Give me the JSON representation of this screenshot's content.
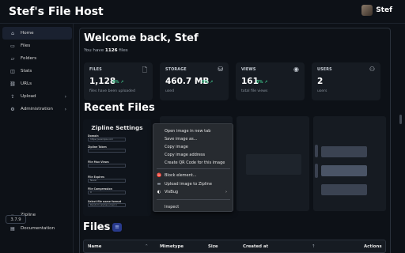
{
  "app": {
    "title": "Stef's File Host",
    "user_name": "Stef"
  },
  "sidebar": {
    "items": [
      {
        "label": "Home",
        "icon": "⌂"
      },
      {
        "label": "Files",
        "icon": "▭"
      },
      {
        "label": "Folders",
        "icon": "▱"
      },
      {
        "label": "Stats",
        "icon": "◫"
      },
      {
        "label": "URLs",
        "icon": "⛓"
      },
      {
        "label": "Upload",
        "icon": "⇪",
        "chevron": "›"
      },
      {
        "label": "Administration",
        "icon": "⚙",
        "chevron": "›"
      }
    ],
    "bottom_items": [
      {
        "label": "Zipline",
        "icon": "⌁"
      },
      {
        "label": "Documentation",
        "icon": "▤"
      }
    ],
    "version": "3.7.9"
  },
  "main": {
    "welcome": "Welcome back, Stef",
    "subtext_prefix": "You have ",
    "file_count": "1126",
    "subtext_suffix": " files",
    "stats": [
      {
        "label": "FILES",
        "icon": "🗋",
        "value": "1,128",
        "change": "0% ↗",
        "sub": "files have been uploaded"
      },
      {
        "label": "STORAGE",
        "icon": "⛁",
        "value": "460.7 MB",
        "change": "0% ↗",
        "sub": "used"
      },
      {
        "label": "VIEWS",
        "icon": "◉",
        "value": "161",
        "change": "0% ↗",
        "sub": "total file views"
      },
      {
        "label": "USERS",
        "icon": "⚇",
        "value": "2",
        "change": "",
        "sub": "users"
      }
    ],
    "recent_title": "Recent Files",
    "files_title": "Files",
    "files_button_icon": "≡"
  },
  "thumbnail": {
    "title": "Zipline Settings",
    "fields": [
      {
        "label": "Domain",
        "value": "https://example.com"
      },
      {
        "label": "Zipline Token",
        "value": ""
      },
      {
        "label": "File Max Views",
        "value": ""
      },
      {
        "label": "File Expires",
        "value": "Never"
      },
      {
        "label": "File Compression",
        "value": "0"
      },
      {
        "label": "Select file name format",
        "value": "Random (alphanumeric)"
      }
    ]
  },
  "context_menu": {
    "items": [
      "Open image in new tab",
      "Save image as...",
      "Copy image",
      "Copy image address",
      "Create QR Code for this image",
      "Block element...",
      "Upload image to Zipline",
      "VisBug",
      "Inspect"
    ],
    "icons": {
      "block": "⛔",
      "upload": "▬",
      "visbug": "◐"
    },
    "submenu_arrow": "›"
  },
  "table": {
    "columns": [
      "Name",
      "Mimetype",
      "Size",
      "Created at",
      "Actions"
    ],
    "sort_icon": "↑",
    "sort_icon_2": "⌃"
  },
  "colors": {
    "accent": "#3ec48a",
    "files_button": "#283a8c"
  }
}
